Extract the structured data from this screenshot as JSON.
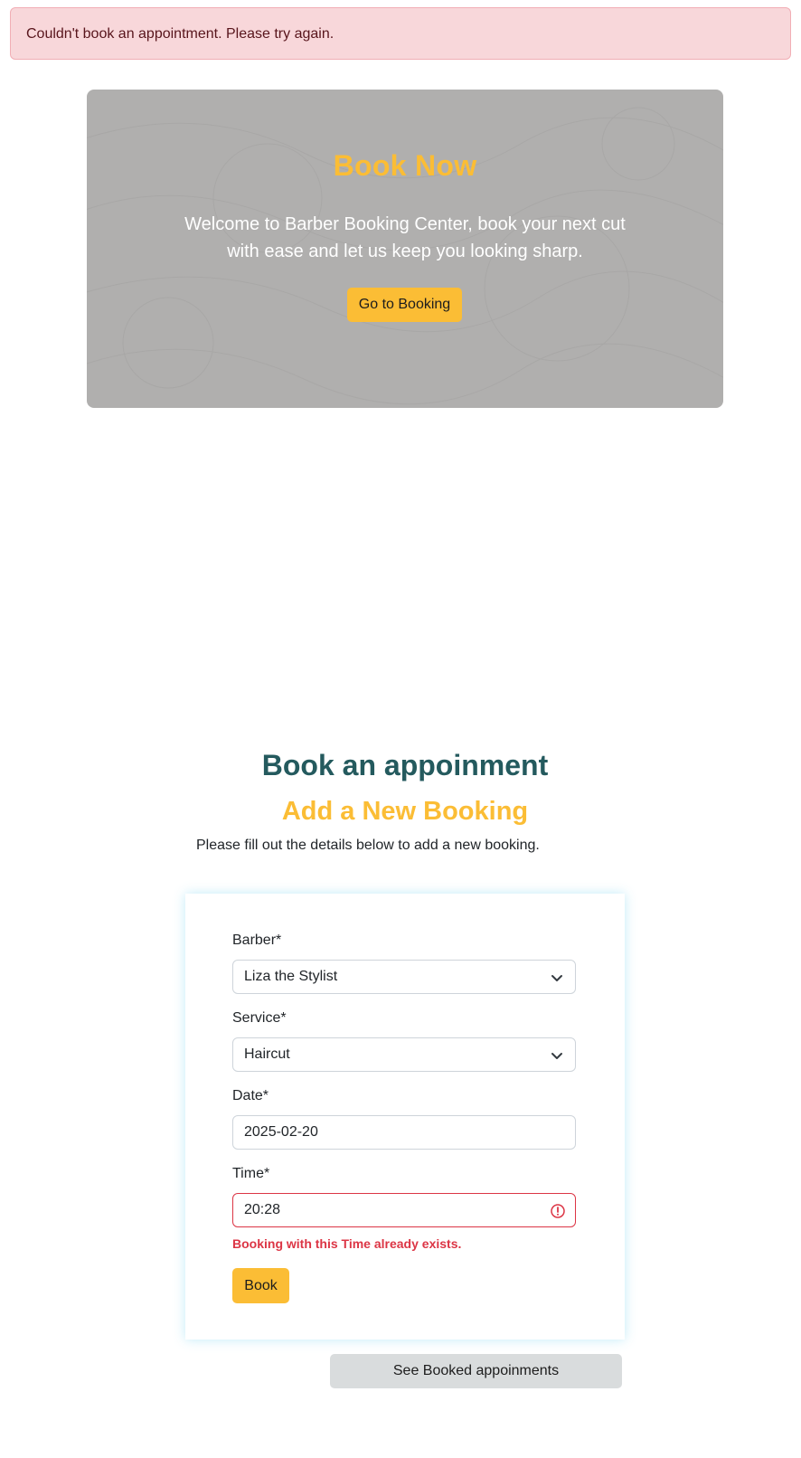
{
  "alert": {
    "message": "Couldn't book an appointment. Please try again."
  },
  "hero": {
    "title": "Book Now",
    "text": "Welcome to Barber Booking Center, book your next cut with ease and let us keep you looking sharp.",
    "button_label": "Go to Booking"
  },
  "booking": {
    "heading": "Book an appoinment",
    "subheading": "Add a New Booking",
    "intro": "Please fill out the details below to add a new booking."
  },
  "form": {
    "barber": {
      "label": "Barber*",
      "value": "Liza the Stylist"
    },
    "service": {
      "label": "Service*",
      "value": "Haircut"
    },
    "date": {
      "label": "Date*",
      "value": "2025-02-20"
    },
    "time": {
      "label": "Time*",
      "value": "20:28",
      "error": "Booking with this Time already exists."
    },
    "submit_label": "Book"
  },
  "see_booked_label": "See Booked appoinments",
  "colors": {
    "accent": "#fbbd35",
    "heading": "#245a5e",
    "error": "#dc3545",
    "alert_bg": "#f8d7da"
  }
}
